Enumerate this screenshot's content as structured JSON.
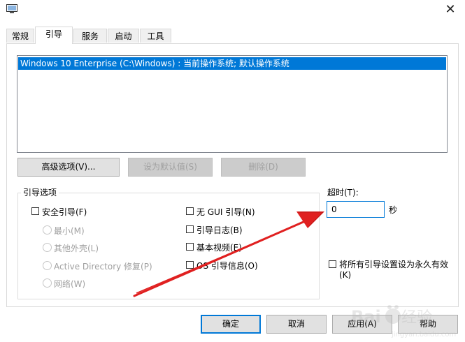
{
  "tabs": [
    {
      "label": "常规"
    },
    {
      "label": "引导"
    },
    {
      "label": "服务"
    },
    {
      "label": "启动"
    },
    {
      "label": "工具"
    }
  ],
  "boot_list": {
    "items": [
      {
        "text": "Windows 10 Enterprise (C:\\Windows) : 当前操作系统; 默认操作系统",
        "selected": true
      }
    ]
  },
  "buttons": {
    "advanced": "高级选项(V)...",
    "set_default": "设为默认值(S)",
    "delete": "删除(D)"
  },
  "boot_options": {
    "group_label": "引导选项",
    "safe_boot": "安全引导(F)",
    "minimal": "最小(M)",
    "alternate_shell": "其他外壳(L)",
    "ad_repair": "Active Directory 修复(P)",
    "network": "网络(W)",
    "no_gui": "无 GUI 引导(N)",
    "boot_log": "引导日志(B)",
    "base_video": "基本视频(E)",
    "os_boot_info": "OS 引导信息(O)"
  },
  "timeout": {
    "label": "超时(T):",
    "value": "0",
    "unit": "秒"
  },
  "make_permanent": {
    "line1": "将所有引导设置设为永久有效",
    "line2": "(K)"
  },
  "footer": {
    "ok": "确定",
    "cancel": "取消",
    "apply": "应用(A)",
    "help": "帮助"
  },
  "colors": {
    "selection": "#0078d7",
    "annotation_arrow": "#e02020"
  }
}
